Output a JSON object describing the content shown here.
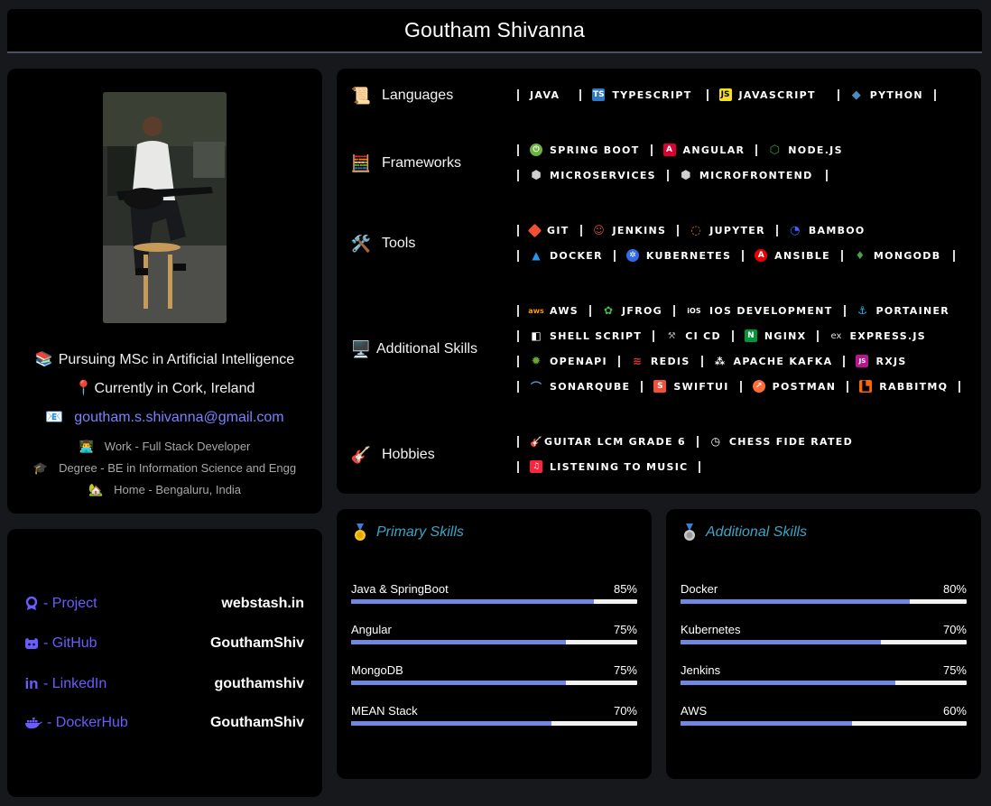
{
  "header": {
    "title": "Goutham Shivanna"
  },
  "profile": {
    "study": "Pursuing MSc in Artificial Intelligence",
    "location": "Currently in Cork, Ireland",
    "email": "goutham.s.shivanna@gmail.com",
    "work": "Work - Full Stack Developer",
    "degree": "Degree - BE in Information Science and Engg",
    "home": "Home - Bengaluru, India"
  },
  "links": [
    {
      "label": "- Project",
      "value": "webstash.in",
      "icon": "project-icon"
    },
    {
      "label": "- GitHub",
      "value": "GouthamShiv",
      "icon": "github-icon"
    },
    {
      "label": "- LinkedIn",
      "value": "gouthamshiv",
      "icon": "linkedin-icon"
    },
    {
      "label": "- DockerHub",
      "value": "GouthamShiv",
      "icon": "docker-icon"
    }
  ],
  "skills": {
    "languages": {
      "label": "Languages",
      "badges": [
        "JAVA",
        "TYPESCRIPT",
        "JAVASCRIPT",
        "PYTHON"
      ]
    },
    "frameworks": {
      "label": "Frameworks",
      "row1": [
        "SPRING BOOT",
        "ANGULAR",
        "NODE.JS"
      ],
      "row2": [
        "MICROSERVICES",
        "MICROFRONTEND"
      ]
    },
    "tools": {
      "label": "Tools",
      "row1": [
        "GIT",
        "JENKINS",
        "JUPYTER",
        "BAMBOO"
      ],
      "row2": [
        "DOCKER",
        "KUBERNETES",
        "ANSIBLE",
        "MONGODB"
      ]
    },
    "additional": {
      "label": "Additional Skills",
      "row1": [
        "AWS",
        "JFROG",
        "IOS DEVELOPMENT",
        "PORTAINER"
      ],
      "row2": [
        "SHELL SCRIPT",
        "CI CD",
        "NGINX",
        "EXPRESS.JS"
      ],
      "row3": [
        "OPENAPI",
        "REDIS",
        "APACHE KAFKA",
        "RXJS"
      ],
      "row4": [
        "SONARQUBE",
        "SWIFTUI",
        "POSTMAN",
        "RABBITMQ"
      ]
    },
    "hobbies": {
      "label": "Hobbies",
      "row1": [
        "GUITAR LCM GRADE 6",
        "CHESS FIDE RATED"
      ],
      "row2": [
        "LISTENING TO MUSIC"
      ]
    }
  },
  "primary_skills": {
    "title": "Primary Skills",
    "items": [
      {
        "name": "Java & SpringBoot",
        "pct_label": "85%",
        "value": 85
      },
      {
        "name": "Angular",
        "pct_label": "75%",
        "value": 75
      },
      {
        "name": "MongoDB",
        "pct_label": "75%",
        "value": 75
      },
      {
        "name": "MEAN Stack",
        "pct_label": "70%",
        "value": 70
      }
    ]
  },
  "additional_skills": {
    "title": "Additional Skills",
    "items": [
      {
        "name": "Docker",
        "pct_label": "80%",
        "value": 80
      },
      {
        "name": "Kubernetes",
        "pct_label": "70%",
        "value": 70
      },
      {
        "name": "Jenkins",
        "pct_label": "75%",
        "value": 75
      },
      {
        "name": "AWS",
        "pct_label": "60%",
        "value": 60
      }
    ]
  },
  "colors": {
    "link": "#6b5cff",
    "email": "#7a82ff",
    "progress": "#7088e0",
    "section_title": "#3aa6c4"
  }
}
